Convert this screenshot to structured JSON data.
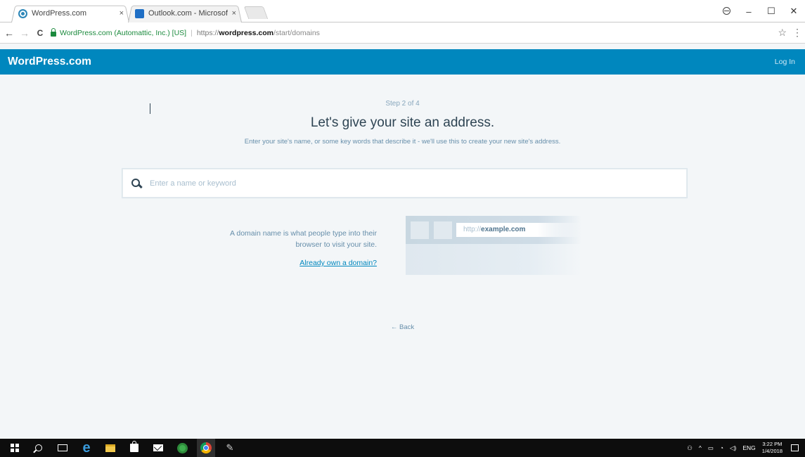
{
  "browser": {
    "tabs": [
      {
        "title": "WordPress.com",
        "close": "×",
        "icon": "wordpress-icon"
      },
      {
        "title": "Outlook.com - Microsof",
        "close": "×",
        "icon": "outlook-icon"
      }
    ],
    "window_controls": {
      "minimize": "–",
      "maximize": "☐",
      "close": "✕"
    },
    "nav": {
      "back": "←",
      "forward": "→",
      "reload": "C"
    },
    "address": {
      "secure_label": "WordPress.com (Automattic, Inc.) [US]",
      "separator": "|",
      "scheme": "https://",
      "host": "wordpress.com",
      "path": "/start/domains"
    },
    "star": "☆",
    "menu": "⋮"
  },
  "masterbar": {
    "logo": "WordPress.com",
    "login": "Log In"
  },
  "main": {
    "step": "Step 2 of 4",
    "headline": "Let's give your site an address.",
    "subhead": "Enter your site's name, or some key words that describe it - we'll use this to create your new site's address.",
    "search": {
      "placeholder": "Enter a name or keyword",
      "value": ""
    },
    "explainer": "A domain name is what people type into their browser to visit your site.",
    "already_own": "Already own a domain?",
    "illustration": {
      "scheme": "http://",
      "domain": "example.com"
    },
    "back": "← Back"
  },
  "taskbar": {
    "tray": {
      "people": "⚇",
      "chevron": "^",
      "lang": "ENG",
      "time": "3:22 PM",
      "date": "1/4/2018"
    }
  }
}
